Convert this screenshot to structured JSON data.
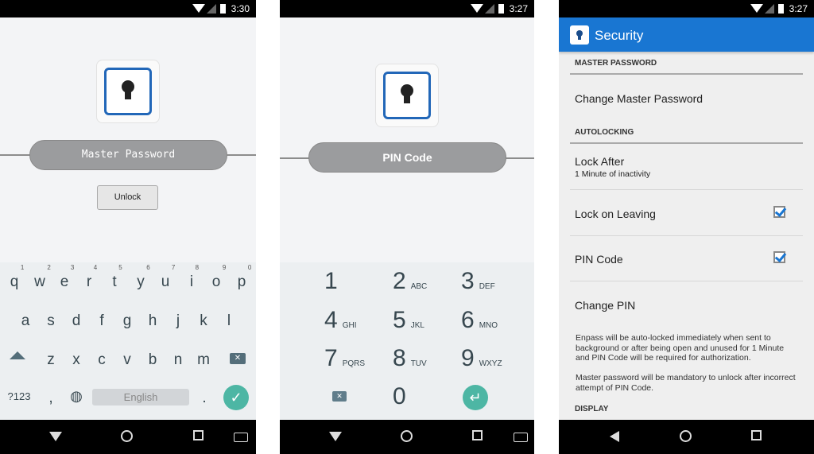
{
  "screens": [
    {
      "status_time": "3:30",
      "password_placeholder": "Master Password",
      "unlock_label": "Unlock",
      "keyboard": {
        "rows": [
          [
            "q",
            "w",
            "e",
            "r",
            "t",
            "y",
            "u",
            "i",
            "o",
            "p"
          ],
          [
            "a",
            "s",
            "d",
            "f",
            "g",
            "h",
            "j",
            "k",
            "l"
          ],
          [
            "z",
            "x",
            "c",
            "v",
            "b",
            "n",
            "m"
          ]
        ],
        "hints": [
          "1",
          "2",
          "3",
          "4",
          "5",
          "6",
          "7",
          "8",
          "9",
          "0"
        ],
        "symbols_label": "?123",
        "comma": ",",
        "period": ".",
        "space_label": "English"
      },
      "accent": "#4db6a4"
    },
    {
      "status_time": "3:27",
      "pin_placeholder": "PIN Code",
      "keypad": [
        {
          "d": "1",
          "l": ""
        },
        {
          "d": "2",
          "l": "ABC"
        },
        {
          "d": "3",
          "l": "DEF"
        },
        {
          "d": "4",
          "l": "GHI"
        },
        {
          "d": "5",
          "l": "JKL"
        },
        {
          "d": "6",
          "l": "MNO"
        },
        {
          "d": "7",
          "l": "PQRS"
        },
        {
          "d": "8",
          "l": "TUV"
        },
        {
          "d": "9",
          "l": "WXYZ"
        },
        {
          "d": "0",
          "l": ""
        }
      ]
    },
    {
      "status_time": "3:27",
      "title": "Security",
      "app_bar_color": "#1976d2",
      "sections": {
        "master_password": "MASTER PASSWORD",
        "autolocking": "AUTOLOCKING",
        "display": "DISPLAY"
      },
      "items": {
        "change_master": "Change Master Password",
        "lock_after": "Lock After",
        "lock_after_value": "1 Minute of inactivity",
        "lock_on_leaving": "Lock on Leaving",
        "lock_on_leaving_checked": true,
        "pin_code": "PIN Code",
        "pin_code_checked": true,
        "change_pin": "Change PIN"
      },
      "description_1": "Enpass will be auto-locked immediately when sent to background or after being open and unused for 1 Minute and PIN Code will be required for authorization.",
      "description_2": "Master password will be mandatory to unlock after incorrect attempt of PIN Code."
    }
  ]
}
